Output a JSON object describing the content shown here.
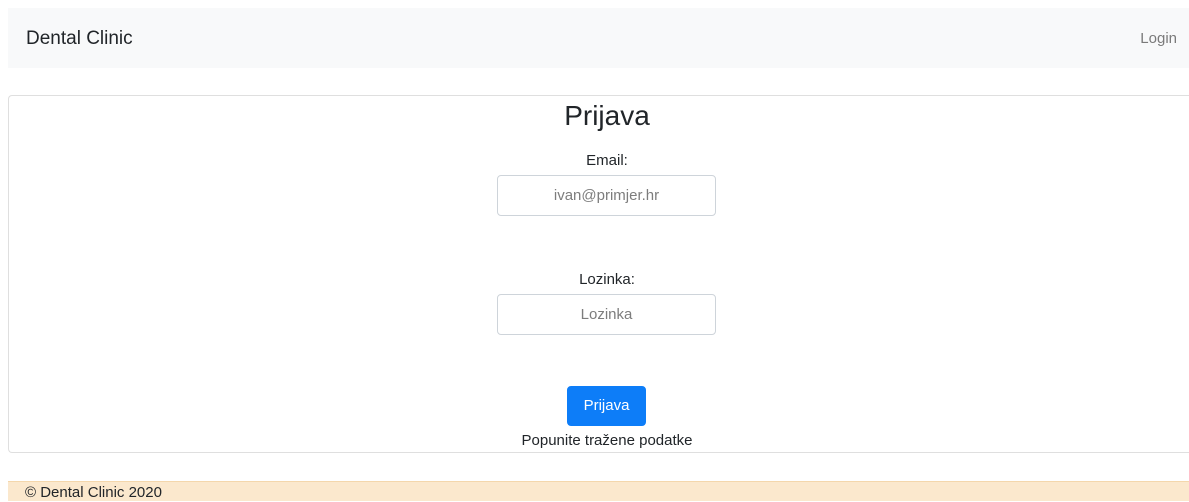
{
  "navbar": {
    "brand": "Dental Clinic",
    "login_label": "Login"
  },
  "login_form": {
    "title": "Prijava",
    "email": {
      "label": "Email:",
      "value": "",
      "placeholder": "ivan@primjer.hr"
    },
    "password": {
      "label": "Lozinka:",
      "value": "",
      "placeholder": "Lozinka"
    },
    "submit_label": "Prijava",
    "hint": "Popunite tražene podatke"
  },
  "footer": {
    "text": "© Dental Clinic 2020"
  },
  "colors": {
    "primary": "#0d7df8",
    "navbar_bg": "#f8f9fa",
    "footer_bg": "#fbe8cd"
  }
}
